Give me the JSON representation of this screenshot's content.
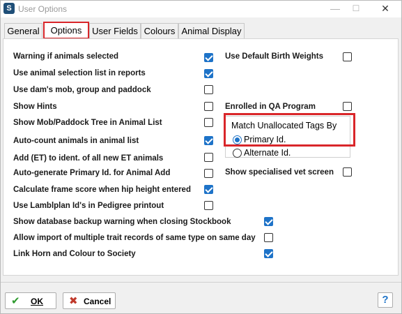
{
  "window": {
    "title": "User Options"
  },
  "titlebar": {
    "minimize": "—",
    "maximize": "☐",
    "close": "✕"
  },
  "tabs": [
    {
      "label": "General"
    },
    {
      "label": "Options"
    },
    {
      "label": "User Fields"
    },
    {
      "label": "Colours"
    },
    {
      "label": "Animal Display"
    }
  ],
  "active_tab": "Options",
  "left_options": [
    {
      "label": "Warning if animals selected",
      "checked": true
    },
    {
      "label": "Use animal selection list in reports",
      "checked": true
    },
    {
      "label": "Use dam's mob, group and paddock",
      "checked": false
    },
    {
      "label": "Show Hints",
      "checked": false
    },
    {
      "label": "Show Mob/Paddock Tree in Animal List",
      "checked": false
    },
    {
      "label": "Auto-count animals in animal list",
      "checked": true
    },
    {
      "label": "Add (ET) to ident. of all new ET animals",
      "checked": false
    },
    {
      "label": "Auto-generate Primary Id. for Animal Add",
      "checked": false
    },
    {
      "label": "Calculate frame score when hip height entered",
      "checked": true
    },
    {
      "label": "Use Lamblplan Id's in Pedigree printout",
      "checked": false
    }
  ],
  "wide_options": [
    {
      "label": "Show database backup warning when closing Stockbook",
      "checked": true
    },
    {
      "label": "Allow import of multiple trait records of same type on same day",
      "checked": false
    },
    {
      "label": "Link Horn and Colour to Society",
      "checked": true
    }
  ],
  "right_options": {
    "default_birth_weights": {
      "label": "Use Default Birth Weights",
      "checked": false
    },
    "qa_program": {
      "label": "Enrolled in QA Program",
      "checked": false
    },
    "vet_screen": {
      "label": "Show specialised vet screen",
      "checked": false
    }
  },
  "match_group": {
    "legend": "Match Unallocated Tags By",
    "options": [
      {
        "label": "Primary Id.",
        "selected": true
      },
      {
        "label": "Alternate Id.",
        "selected": false
      }
    ]
  },
  "footer": {
    "ok_label": "OK",
    "cancel_label": "Cancel",
    "help_label": "?"
  }
}
